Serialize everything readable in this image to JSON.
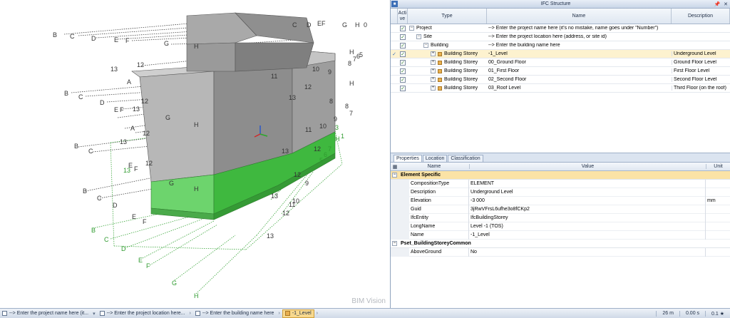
{
  "app": {
    "brand": "BIM Vision"
  },
  "ifc_panel": {
    "title": "IFC Structure",
    "headers": {
      "active": "Acti ve",
      "type": "Type",
      "name": "Name",
      "description": "Description"
    },
    "rows": [
      {
        "type": "Project",
        "name": "--> Enter the project name here (it's no mistake, name goes under \"Number\")",
        "description": ""
      },
      {
        "type": "Site",
        "name": "--> Enter the project location here (address, or site id)",
        "description": ""
      },
      {
        "type": "Building",
        "name": "--> Enter the building name here",
        "description": ""
      },
      {
        "type": "Building Storey",
        "name": "-1_Level",
        "description": "Underground Level"
      },
      {
        "type": "Building Storey",
        "name": "00_Ground Floor",
        "description": "Ground Floor Level"
      },
      {
        "type": "Building Storey",
        "name": "01_First Floor",
        "description": "First Floor Level"
      },
      {
        "type": "Building Storey",
        "name": "02_Second Floor",
        "description": "Second Floor Level"
      },
      {
        "type": "Building Storey",
        "name": "03_Roof Level",
        "description": "Third Floor (on the roof)"
      }
    ]
  },
  "properties_panel": {
    "tabs": [
      "Properties",
      "Location",
      "Classification"
    ],
    "headers": {
      "name": "Name",
      "value": "Value",
      "unit": "Unit"
    },
    "groups": [
      {
        "title": "Element Specific",
        "rows": [
          {
            "name": "CompositionType",
            "value": "ELEMENT",
            "unit": ""
          },
          {
            "name": "Description",
            "value": "Underground Level",
            "unit": ""
          },
          {
            "name": "Elevation",
            "value": "-3 000",
            "unit": "mm"
          },
          {
            "name": "Guid",
            "value": "3jRwVFrsL6ufhe3o8fCKp2",
            "unit": ""
          },
          {
            "name": "IfcEntity",
            "value": "IfcBuildingStorey",
            "unit": ""
          },
          {
            "name": "LongName",
            "value": "Level -1 (TOS)",
            "unit": ""
          },
          {
            "name": "Name",
            "value": "-1_Level",
            "unit": ""
          }
        ]
      },
      {
        "title": "Pset_BuildingStoreyCommon",
        "rows": [
          {
            "name": "AboveGround",
            "value": "No",
            "unit": ""
          }
        ]
      }
    ]
  },
  "status_bar": {
    "crumbs": [
      "--> Enter the project name here (it...",
      "--> Enter the project location here...",
      "--> Enter the building name here",
      "-1_Level"
    ],
    "distance": "26 m",
    "time": "0.00 s",
    "scale": "0.1 ★"
  },
  "colors": {
    "selection": "#fdf2cf",
    "green_level": "#4fc94f",
    "grid_lines": "#555555"
  }
}
